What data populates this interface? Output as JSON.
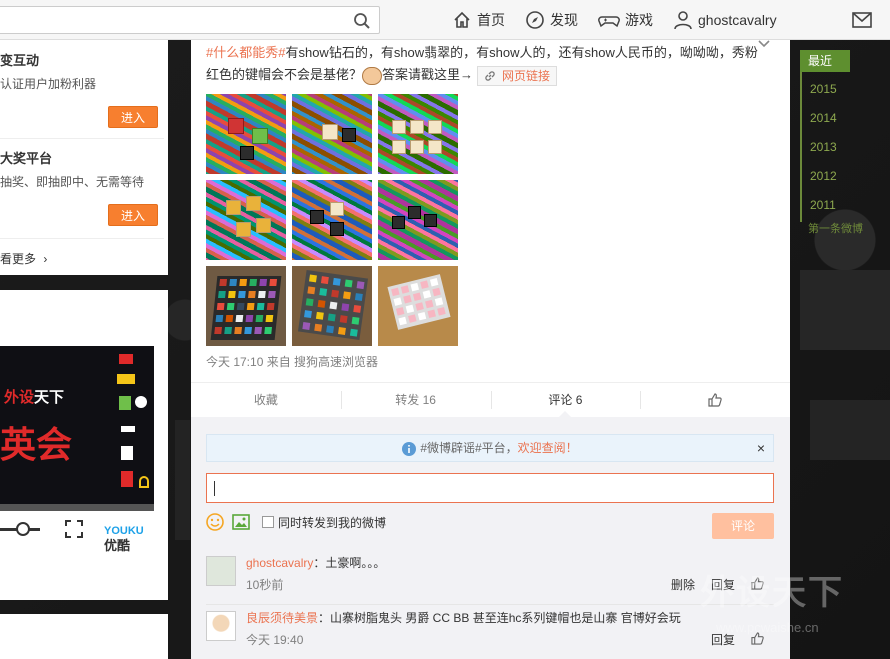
{
  "nav": {
    "home": "首页",
    "discover": "发现",
    "games": "游戏",
    "username": "ghostcavalry"
  },
  "left": {
    "item1": {
      "title": "变互动",
      "desc": "认证用户加粉利器",
      "button": "进入"
    },
    "item2": {
      "title": "大奖平台",
      "desc": "抽奖、即抽即中、无需等待",
      "button": "进入"
    },
    "more": "看更多",
    "video": {
      "brand_a": "外设",
      "brand_b": "天下",
      "title": "英会",
      "youku": "YOUKU",
      "youku_cn": "优酷"
    }
  },
  "post": {
    "hashtag": "#什么都能秀#",
    "text": "有show钻石的，有show翡翠的，有show人的，还有show人民币的，呦呦呦，秀粉红色的键帽会不会是基佬？",
    "text_tail": "答案请戳这里→",
    "link_label": "网页链接",
    "meta": "今天 17:10 来自 搜狗高速浏览器"
  },
  "actions": {
    "favorite": "收藏",
    "repost": "转发 16",
    "comment": "评论 6"
  },
  "comments": {
    "notice_prefix": "#微博辟谣#平台，",
    "notice_link": "欢迎查阅！",
    "also_repost": "同时转发到我的微博",
    "submit": "评论",
    "list": [
      {
        "user": "ghostcavalry",
        "text": "：土豪啊。。。",
        "time": "10秒前",
        "delete": "删除",
        "reply": "回复"
      },
      {
        "user": "良辰须待美景",
        "text": "：山寨树脂鬼头 男爵 CC BB 甚至连hc系列键帽也是山寨 官博好会玩",
        "time": "今天 19:40",
        "reply": "回复"
      }
    ]
  },
  "timeline": {
    "active": "最近",
    "years": [
      "2015",
      "2014",
      "2013",
      "2012",
      "2011"
    ],
    "first": "第一条微博"
  },
  "watermark": {
    "text": "外设天下",
    "url": "www.pcwaishe.cn"
  },
  "colors": {
    "accent": "#eb7350",
    "button": "#f77f2f",
    "timeline": "#5e8f2f"
  }
}
